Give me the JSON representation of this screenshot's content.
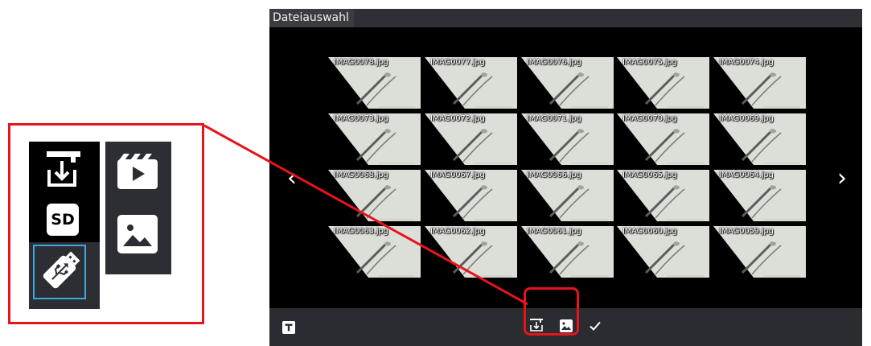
{
  "window": {
    "title": "Dateiauswahl"
  },
  "files": [
    "IMAG0078.jpg",
    "IMAG0077.jpg",
    "IMAG0076.jpg",
    "IMAG0075.jpg",
    "IMAG0074.jpg",
    "IMAG0073.jpg",
    "IMAG0072.jpg",
    "IMAG0071.jpg",
    "IMAG0070.jpg",
    "IMAG0069.jpg",
    "IMAG0068.jpg",
    "IMAG0067.jpg",
    "IMAG0066.jpg",
    "IMAG0065.jpg",
    "IMAG0064.jpg",
    "IMAG0063.jpg",
    "IMAG0062.jpg",
    "IMAG0061.jpg",
    "IMAG0060.jpg",
    "IMAG0059.jpg"
  ],
  "selected_file": "IMAG0078.jpg",
  "navigation": {
    "prev_icon": "chevron-left-icon",
    "next_icon": "chevron-right-icon"
  },
  "toolbar": {
    "left_icon": "text-icon",
    "center_icons": [
      "import-icon",
      "image-icon",
      "checkmark-icon"
    ]
  },
  "callout": {
    "storage_icons": [
      "import-icon",
      "sd-card-icon",
      "usb-icon"
    ],
    "storage_selected": "usb-icon",
    "sd_label": "SD",
    "media_icons": [
      "video-icon",
      "image-icon"
    ]
  },
  "colors": {
    "highlight": "#e8141b",
    "selection": "#4db6e8",
    "titlebar": "#2f3035",
    "toolbar": "#2b2c31"
  }
}
